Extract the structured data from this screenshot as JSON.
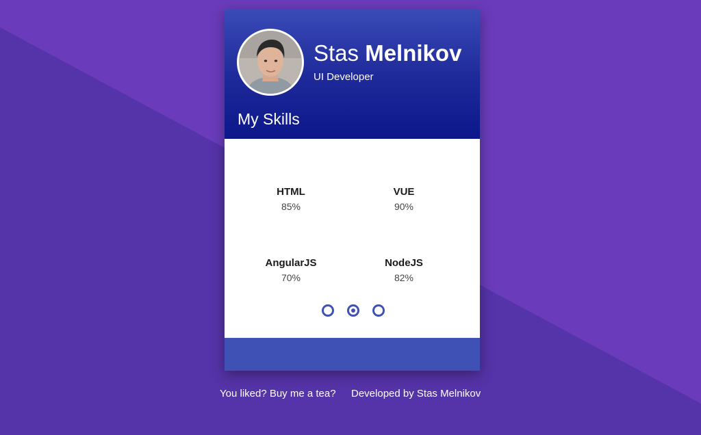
{
  "profile": {
    "first_name": "Stas",
    "last_name": "Melnikov",
    "role": "UI Developer"
  },
  "skills_title": "My Skills",
  "skills": [
    {
      "name": "HTML",
      "value": "85%"
    },
    {
      "name": "VUE",
      "value": "90%"
    },
    {
      "name": "AngularJS",
      "value": "70%"
    },
    {
      "name": "NodeJS",
      "value": "82%"
    }
  ],
  "pagination": {
    "count": 3,
    "active_index": 1
  },
  "footer_links": [
    {
      "label": "You liked? Buy me a tea?"
    },
    {
      "label": "Developed by Stas Melnikov"
    }
  ],
  "colors": {
    "background": "#5533a8",
    "header_top": "#3a4bb8",
    "header_bottom": "#0c188a",
    "accent": "#3f51b5"
  }
}
